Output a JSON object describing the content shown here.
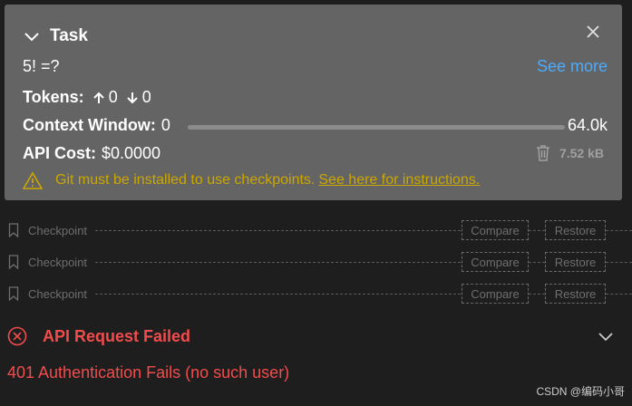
{
  "task": {
    "title": "Task",
    "text": "5!  =?",
    "see_more": "See more",
    "tokens_label": "Tokens:",
    "tokens_in": "0",
    "tokens_out": "0",
    "context_label": "Context Window:",
    "context_used": "0",
    "context_max": "64.0k",
    "cost_label": "API Cost:",
    "cost_value": "$0.0000",
    "size": "7.52 kB",
    "warning_text": "Git must be installed to use checkpoints.",
    "warning_link": "See here for instructions."
  },
  "checkpoints": [
    {
      "label": "Checkpoint",
      "compare": "Compare",
      "restore": "Restore"
    },
    {
      "label": "Checkpoint",
      "compare": "Compare",
      "restore": "Restore"
    },
    {
      "label": "Checkpoint",
      "compare": "Compare",
      "restore": "Restore"
    }
  ],
  "error": {
    "title": "API Request Failed",
    "message": "401 Authentication Fails (no such user)"
  },
  "watermark": "CSDN @编码小哥",
  "colors": {
    "panel": "#646464",
    "background": "#1e1e1e",
    "link": "#4daafc",
    "warning": "#cca700",
    "error": "#f14c4c"
  },
  "icons": [
    "chevron-down-icon",
    "close-icon",
    "arrow-up-icon",
    "arrow-down-icon",
    "trash-icon",
    "warning-icon",
    "bookmark-icon",
    "error-circle-icon"
  ]
}
